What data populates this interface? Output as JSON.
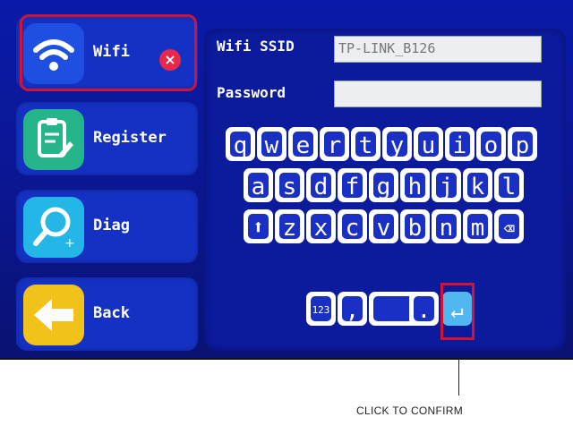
{
  "menu": {
    "wifi_label": "Wifi",
    "register_label": "Register",
    "diag_label": "Diag",
    "back_label": "Back",
    "close_glyph": "×"
  },
  "form": {
    "ssid_label": "Wifi SSID",
    "ssid_value": "TP-LINK_B126",
    "password_label": "Password",
    "password_value": ""
  },
  "keyboard": {
    "row1": [
      "q",
      "w",
      "e",
      "r",
      "t",
      "y",
      "u",
      "i",
      "o",
      "p"
    ],
    "row2": [
      "a",
      "s",
      "d",
      "f",
      "g",
      "h",
      "j",
      "k",
      "l"
    ],
    "row3": [
      "z",
      "x",
      "c",
      "v",
      "b",
      "n",
      "m"
    ],
    "shift_glyph": "⬆",
    "backspace_glyph": "⌫",
    "numbers_label": "123",
    "comma_label": ",",
    "space_label": "",
    "period_label": ".",
    "enter_glyph": "↵"
  },
  "annotation": {
    "caption": "CLICK TO CONFIRM"
  },
  "icons": {
    "wifi": "wifi-icon",
    "register": "clipboard-icon",
    "diag": "magnifier-icon",
    "back": "arrow-left-icon"
  },
  "colors": {
    "screen_bg": "#0b1690",
    "highlight": "#d11435",
    "wifi_tile": "#1e4fe0",
    "register_tile": "#26b48a",
    "diag_tile": "#23b6e6",
    "back_tile": "#f0c21a"
  }
}
